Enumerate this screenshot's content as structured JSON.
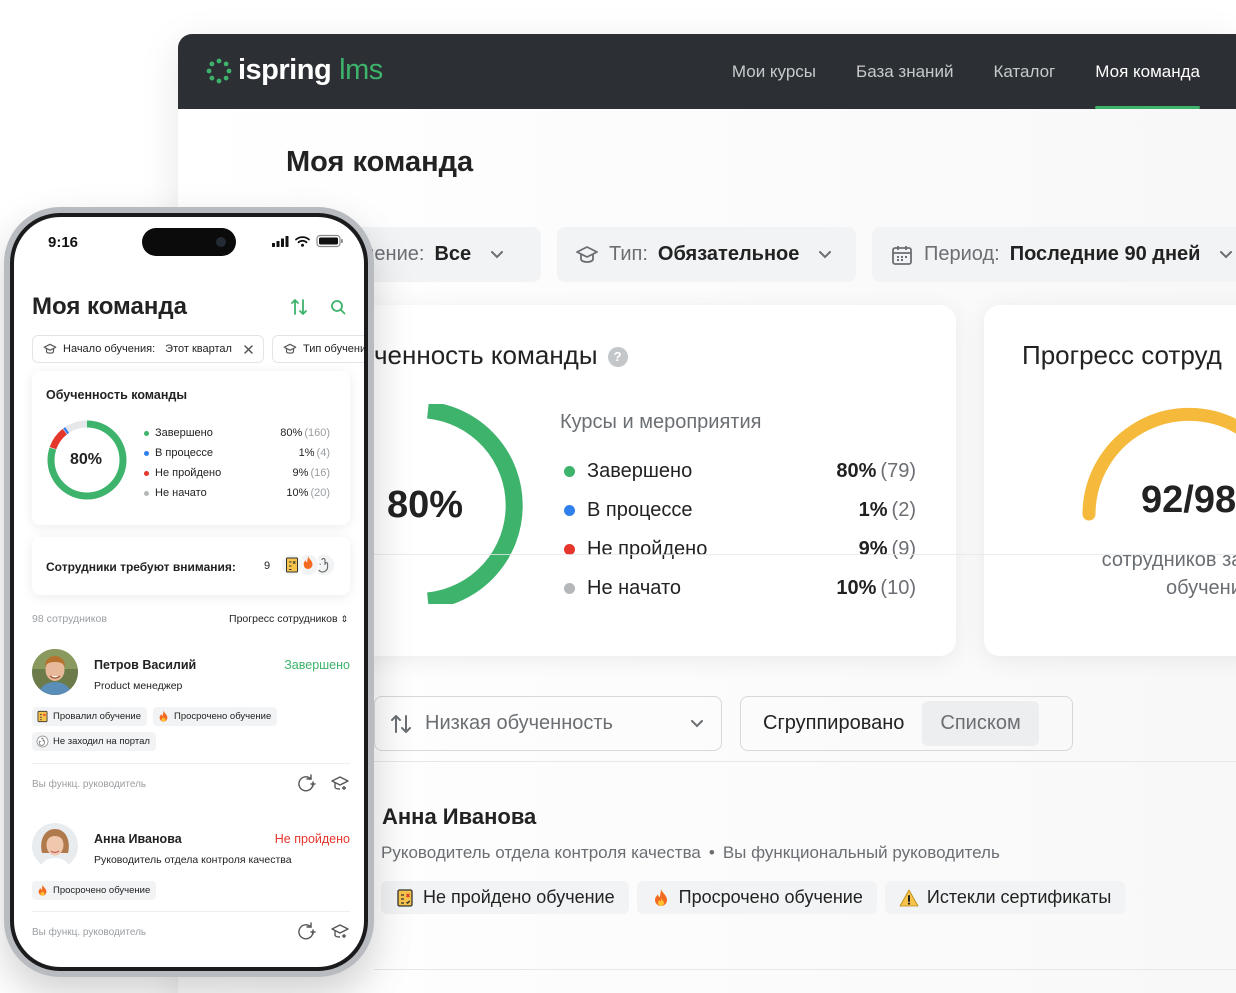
{
  "colors": {
    "brand_green": "#3db36b",
    "topbar": "#2c2f33",
    "status_completed": "#3db36b",
    "status_in_progress": "#2f80ed",
    "status_failed": "#e5362c",
    "status_not_started": "#b5b8bb",
    "gauge": "#f5b93b"
  },
  "desktop": {
    "logo": {
      "brand": "ispring",
      "product": "lms"
    },
    "nav": [
      "Мои курсы",
      "База знаний",
      "Каталог",
      "Моя команда"
    ],
    "nav_active": "Моя команда",
    "page_title": "Моя команда",
    "filters": [
      {
        "label": "чение:",
        "value": "Все",
        "icon": "none"
      },
      {
        "label": "Тип:",
        "value": "Обязательное",
        "icon": "graduation-cap-icon"
      },
      {
        "label": "Период:",
        "value": "Последние 90 дней",
        "icon": "calendar-icon"
      }
    ],
    "team_card": {
      "title": "ченность команды",
      "percent": "80%",
      "legend_title": "Курсы и мероприятия",
      "legend": [
        {
          "name": "Завершено",
          "pct": "80%",
          "count": "(79)",
          "color": "#3db36b"
        },
        {
          "name": "В процессе",
          "pct": "1%",
          "count": "(2)",
          "color": "#2f80ed"
        },
        {
          "name": "Не пройдено",
          "pct": "9%",
          "count": "(9)",
          "color": "#e5362c"
        },
        {
          "name": "Не начато",
          "pct": "10%",
          "count": "(10)",
          "color": "#b5b8bb"
        }
      ]
    },
    "progress_card": {
      "title": "Прогресс сотруд",
      "value": "92/98",
      "caption_line1": "сотрудников зав",
      "caption_line2": "обучение",
      "fraction": 0.94
    },
    "sort": {
      "label": "Низкая обученность"
    },
    "view_toggle": {
      "options": [
        "Сгруппировано",
        "Списком"
      ],
      "active": "Списком"
    },
    "person": {
      "name": "Анна Иванова",
      "role": "Руководитель отдела контроля качества",
      "sep": "•",
      "relation": "Вы функциональный руководитель",
      "tags": [
        {
          "label": "Не пройдено обучение",
          "icon": "failed-course-icon"
        },
        {
          "label": "Просрочено обучение",
          "icon": "fire-icon"
        },
        {
          "label": "Истекли сертификаты",
          "icon": "warning-icon"
        }
      ]
    }
  },
  "mobile": {
    "time": "9:16",
    "title": "Моя команда",
    "filters": [
      {
        "label": "Начало обучения:",
        "value": "Этот квартал"
      },
      {
        "label": "Тип обучени",
        "value": ""
      }
    ],
    "team_card": {
      "title": "Обученность команды",
      "percent": "80%",
      "legend": [
        {
          "name": "Завершено",
          "pct": "80%",
          "count": "(160)",
          "color": "#3db36b"
        },
        {
          "name": "В процессе",
          "pct": "1%",
          "count": "(4)",
          "color": "#2f80ed"
        },
        {
          "name": "Не пройдено",
          "pct": "9%",
          "count": "(16)",
          "color": "#e5362c"
        },
        {
          "name": "Не начато",
          "pct": "10%",
          "count": "(20)",
          "color": "#b5b8bb"
        }
      ]
    },
    "attention": {
      "label": "Сотрудники требуют внимания:",
      "count": "9"
    },
    "employee_count": "98 сотрудников",
    "sort_label": "Прогресс сотрудников",
    "people": [
      {
        "name": "Петров Василий",
        "role": "Product менеджер",
        "status": "Завершено",
        "status_color": "#3db36b",
        "tags": [
          "Провалил обучение",
          "Просрочено обучение",
          "Не заходил на портал"
        ],
        "footer": "Вы функц. руководитель"
      },
      {
        "name": "Анна Иванова",
        "role": "Руководитель отдела контроля качества",
        "status": "Не пройдено",
        "status_color": "#e5362c",
        "tags": [
          "Просрочено обучение"
        ],
        "footer": "Вы функц. руководитель"
      }
    ]
  }
}
